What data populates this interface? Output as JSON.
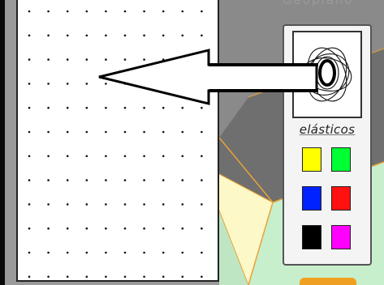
{
  "header_partial_text": "Geoplano",
  "tool": {
    "name": "elásticos",
    "icon": "elastic-bands-icon"
  },
  "colors": [
    {
      "name": "yellow",
      "hex": "#ffff00"
    },
    {
      "name": "green",
      "hex": "#00ff33"
    },
    {
      "name": "blue",
      "hex": "#0022ff"
    },
    {
      "name": "red",
      "hex": "#ff1111"
    },
    {
      "name": "black",
      "hex": "#000000"
    },
    {
      "name": "magenta",
      "hex": "#ff00ff"
    }
  ],
  "annotation": {
    "icon": "left-arrow-icon",
    "color": "#000000"
  }
}
